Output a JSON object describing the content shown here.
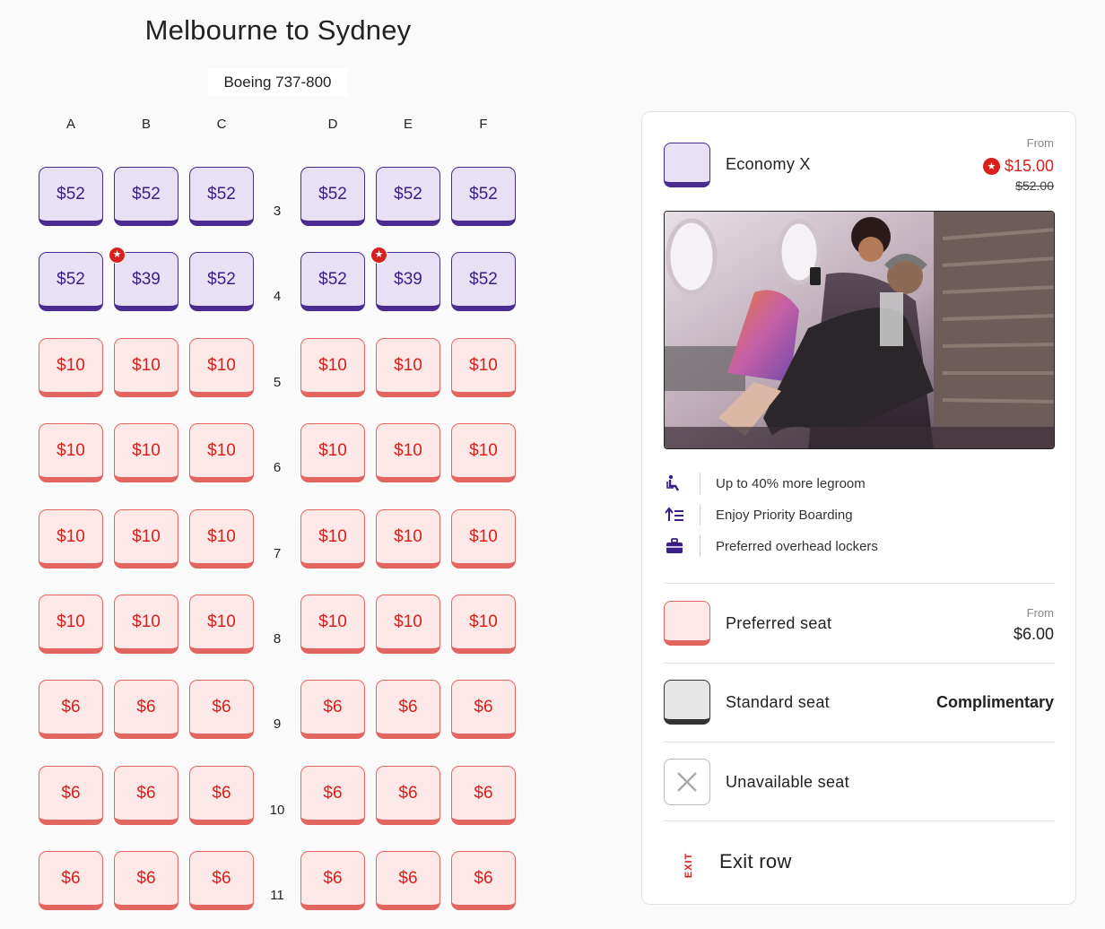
{
  "header": {
    "title": "Melbourne to Sydney",
    "aircraft": "Boeing 737-800"
  },
  "columns": [
    "A",
    "B",
    "C",
    "D",
    "E",
    "F"
  ],
  "rows": [
    {
      "num": "3",
      "type": "econx",
      "seats": [
        {
          "col": "A",
          "price": "$52"
        },
        {
          "col": "B",
          "price": "$52"
        },
        {
          "col": "C",
          "price": "$52"
        },
        {
          "col": "D",
          "price": "$52"
        },
        {
          "col": "E",
          "price": "$52"
        },
        {
          "col": "F",
          "price": "$52"
        }
      ]
    },
    {
      "num": "4",
      "type": "econx",
      "seats": [
        {
          "col": "A",
          "price": "$52"
        },
        {
          "col": "B",
          "price": "$39",
          "star": true
        },
        {
          "col": "C",
          "price": "$52"
        },
        {
          "col": "D",
          "price": "$52"
        },
        {
          "col": "E",
          "price": "$39",
          "star": true
        },
        {
          "col": "F",
          "price": "$52"
        }
      ]
    },
    {
      "num": "5",
      "type": "pref",
      "seats": [
        {
          "col": "A",
          "price": "$10"
        },
        {
          "col": "B",
          "price": "$10"
        },
        {
          "col": "C",
          "price": "$10"
        },
        {
          "col": "D",
          "price": "$10"
        },
        {
          "col": "E",
          "price": "$10"
        },
        {
          "col": "F",
          "price": "$10"
        }
      ]
    },
    {
      "num": "6",
      "type": "pref",
      "seats": [
        {
          "col": "A",
          "price": "$10"
        },
        {
          "col": "B",
          "price": "$10"
        },
        {
          "col": "C",
          "price": "$10"
        },
        {
          "col": "D",
          "price": "$10"
        },
        {
          "col": "E",
          "price": "$10"
        },
        {
          "col": "F",
          "price": "$10"
        }
      ]
    },
    {
      "num": "7",
      "type": "pref",
      "seats": [
        {
          "col": "A",
          "price": "$10"
        },
        {
          "col": "B",
          "price": "$10"
        },
        {
          "col": "C",
          "price": "$10"
        },
        {
          "col": "D",
          "price": "$10"
        },
        {
          "col": "E",
          "price": "$10"
        },
        {
          "col": "F",
          "price": "$10"
        }
      ]
    },
    {
      "num": "8",
      "type": "pref",
      "seats": [
        {
          "col": "A",
          "price": "$10"
        },
        {
          "col": "B",
          "price": "$10"
        },
        {
          "col": "C",
          "price": "$10"
        },
        {
          "col": "D",
          "price": "$10"
        },
        {
          "col": "E",
          "price": "$10"
        },
        {
          "col": "F",
          "price": "$10"
        }
      ]
    },
    {
      "num": "9",
      "type": "pref",
      "seats": [
        {
          "col": "A",
          "price": "$6"
        },
        {
          "col": "B",
          "price": "$6"
        },
        {
          "col": "C",
          "price": "$6"
        },
        {
          "col": "D",
          "price": "$6"
        },
        {
          "col": "E",
          "price": "$6"
        },
        {
          "col": "F",
          "price": "$6"
        }
      ]
    },
    {
      "num": "10",
      "type": "pref",
      "seats": [
        {
          "col": "A",
          "price": "$6"
        },
        {
          "col": "B",
          "price": "$6"
        },
        {
          "col": "C",
          "price": "$6"
        },
        {
          "col": "D",
          "price": "$6"
        },
        {
          "col": "E",
          "price": "$6"
        },
        {
          "col": "F",
          "price": "$6"
        }
      ]
    },
    {
      "num": "11",
      "type": "pref",
      "seats": [
        {
          "col": "A",
          "price": "$6"
        },
        {
          "col": "B",
          "price": "$6"
        },
        {
          "col": "C",
          "price": "$6"
        },
        {
          "col": "D",
          "price": "$6"
        },
        {
          "col": "E",
          "price": "$6"
        },
        {
          "col": "F",
          "price": "$6"
        }
      ]
    }
  ],
  "legend": {
    "econx": {
      "name": "Economy X",
      "from_label": "From",
      "price": "$15.00",
      "old_price": "$52.00"
    },
    "features": [
      {
        "icon": "legroom-icon",
        "text": "Up to 40% more legroom"
      },
      {
        "icon": "priority-boarding-icon",
        "text": "Enjoy Priority Boarding"
      },
      {
        "icon": "overhead-locker-icon",
        "text": "Preferred overhead lockers"
      }
    ],
    "preferred": {
      "name": "Preferred seat",
      "from_label": "From",
      "price": "$6.00"
    },
    "standard": {
      "name": "Standard seat",
      "price": "Complimentary"
    },
    "unavailable": {
      "name": "Unavailable seat"
    },
    "exit": {
      "tag": "EXIT",
      "name": "Exit row"
    }
  },
  "colors": {
    "econx_fill": "#e8e0f4",
    "econx_border": "#4a2b8f",
    "pref_fill": "#fde8e8",
    "pref_border": "#e2665f",
    "brand_red": "#d8201d"
  }
}
